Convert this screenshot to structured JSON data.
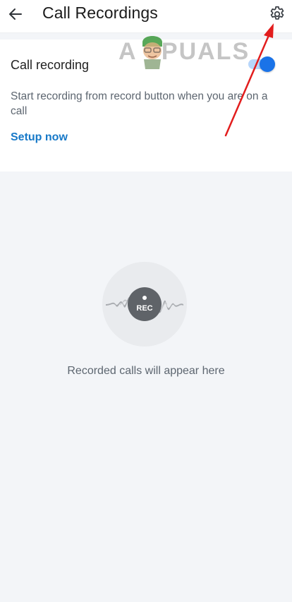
{
  "header": {
    "back_icon": "back-arrow-icon",
    "title": "Call Recordings",
    "settings_icon": "gear-icon"
  },
  "recording_card": {
    "toggle_label": "Call recording",
    "toggle_state": "on",
    "description": "Start recording from record button when you are on a call",
    "setup_link": "Setup now"
  },
  "empty_state": {
    "badge_text": "REC",
    "message": "Recorded calls will appear here"
  },
  "watermark": {
    "text": "APPUALS"
  },
  "colors": {
    "accent_blue": "#1a73e8",
    "link_blue": "#1779c8",
    "annotation_red": "#e21d1d",
    "background": "#f3f5f8"
  }
}
